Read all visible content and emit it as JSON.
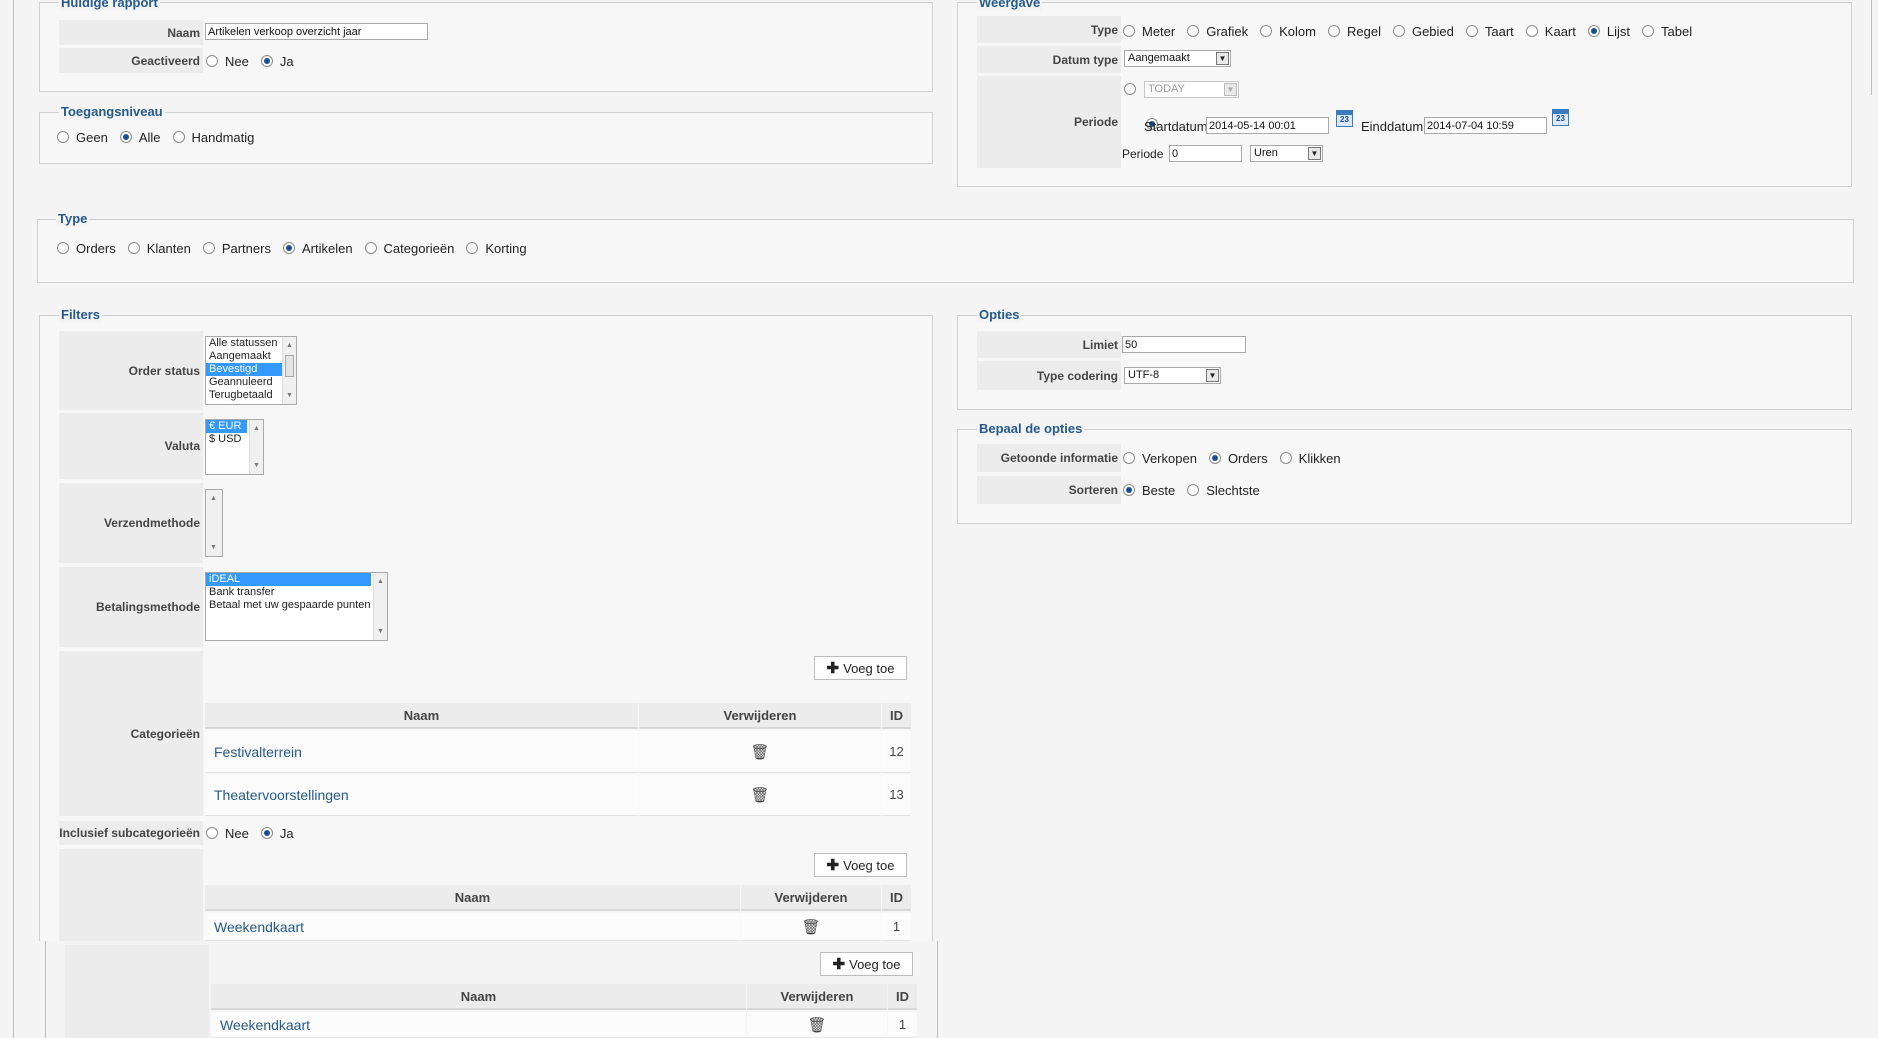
{
  "huidig": {
    "legend": "Huidige rapport",
    "naam_label": "Naam",
    "naam_value": "Artikelen verkoop overzicht jaar",
    "geactiveerd_label": "Geactiveerd",
    "geactiveerd_options": [
      "Nee",
      "Ja"
    ],
    "geactiveerd_selected": "Ja"
  },
  "toegang": {
    "legend": "Toegangsniveau",
    "options": [
      "Geen",
      "Alle",
      "Handmatig"
    ],
    "selected": "Alle"
  },
  "weergave": {
    "legend": "Weergave",
    "type_label": "Type",
    "type_options": [
      "Meter",
      "Grafiek",
      "Kolom",
      "Regel",
      "Gebied",
      "Taart",
      "Kaart",
      "Lijst",
      "Tabel"
    ],
    "type_selected": "Lijst",
    "datum_type_label": "Datum type",
    "datum_type_value": "Aangemaakt",
    "periode_label": "Periode",
    "today_value": "TODAY",
    "startdatum_label": "Startdatum",
    "startdatum_value": "2014-05-14 00:01",
    "einddatum_label": "Einddatum",
    "einddatum_value": "2014-07-04 10:59",
    "calendar_text": "23",
    "periode_inner_label": "Periode",
    "periode_value": "0",
    "periode_unit": "Uren"
  },
  "type": {
    "legend": "Type",
    "options": [
      "Orders",
      "Klanten",
      "Partners",
      "Artikelen",
      "Categorieën",
      "Korting"
    ],
    "selected": "Artikelen"
  },
  "filters": {
    "legend": "Filters",
    "order_status_label": "Order status",
    "order_status_items": [
      "Alle statussen",
      "Aangemaakt",
      "Bevestigd",
      "Geannuleerd",
      "Terugbetaald"
    ],
    "order_status_selected": "Bevestigd",
    "valuta_label": "Valuta",
    "valuta_items": [
      "€ EUR",
      "$ USD"
    ],
    "valuta_selected": "€ EUR",
    "verzend_label": "Verzendmethode",
    "betaling_label": "Betalingsmethode",
    "betaling_items": [
      "iDEAL",
      "Bank transfer",
      "Betaal met uw gespaarde punten"
    ],
    "betaling_selected": "iDEAL",
    "categorieen_label": "Categorieën",
    "add_button": "Voeg toe",
    "col_naam": "Naam",
    "col_verwijderen": "Verwijderen",
    "col_id": "ID",
    "categorieen_rows": [
      {
        "naam": "Festivalterrein",
        "id": "12"
      },
      {
        "naam": "Theatervoorstellingen",
        "id": "13"
      }
    ],
    "subcat_label": "Inclusief subcategorieën",
    "subcat_options": [
      "Nee",
      "Ja"
    ],
    "subcat_selected": "Ja",
    "artikel_rows": [
      {
        "naam": "Weekendkaart",
        "id": "1"
      }
    ],
    "artikel_rows_2": [
      {
        "naam": "Weekendkaart",
        "id": "1"
      }
    ]
  },
  "opties": {
    "legend": "Opties",
    "limiet_label": "Limiet",
    "limiet_value": "50",
    "codering_label": "Type codering",
    "codering_value": "UTF-8"
  },
  "bepaal": {
    "legend": "Bepaal de opties",
    "info_label": "Getoonde informatie",
    "info_options": [
      "Verkopen",
      "Orders",
      "Klikken"
    ],
    "info_selected": "Orders",
    "sorteren_label": "Sorteren",
    "sorteren_options": [
      "Beste",
      "Slechtste"
    ],
    "sorteren_selected": "Beste"
  }
}
